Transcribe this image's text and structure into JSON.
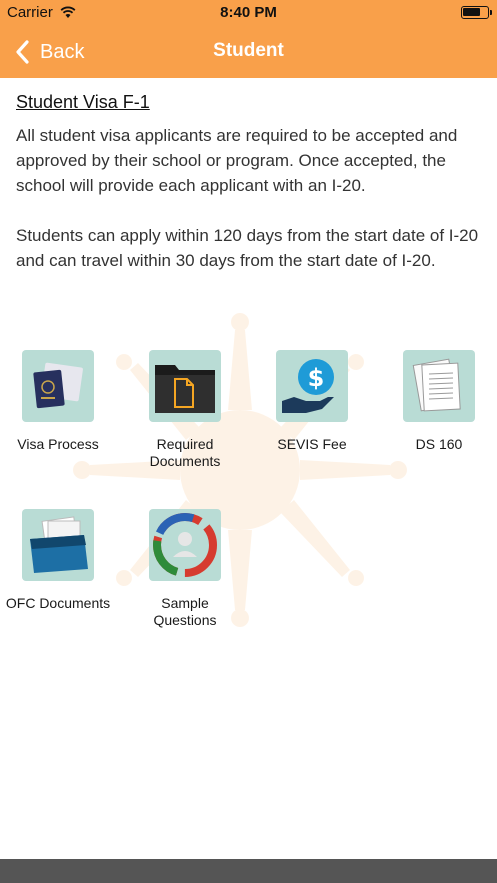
{
  "status_bar": {
    "carrier": "Carrier",
    "time": "8:40 PM"
  },
  "nav": {
    "back_label": "Back",
    "title": "Student"
  },
  "content": {
    "heading": "Student Visa F-1",
    "paragraph1": " All student visa applicants are required to be accepted and approved by their school or program. Once accepted, the school will provide each applicant with an I-20.",
    "paragraph2": "Students can apply within 120 days from the start date of I-20 and can travel within 30 days from the start date of I-20."
  },
  "tiles": [
    {
      "label": "Visa Process",
      "icon": "passport-icon"
    },
    {
      "label": "Required Documents",
      "icon": "folder-document-icon"
    },
    {
      "label": "SEVIS Fee",
      "icon": "dollar-hand-icon"
    },
    {
      "label": "DS 160",
      "icon": "papers-icon"
    },
    {
      "label": "OFC Documents",
      "icon": "file-folder-icon"
    },
    {
      "label": "Sample Questions",
      "icon": "questions-icon"
    }
  ],
  "colors": {
    "accent": "#f9a04a",
    "tile_bg": "#b9dcd5",
    "bottom_bar": "#555555"
  }
}
